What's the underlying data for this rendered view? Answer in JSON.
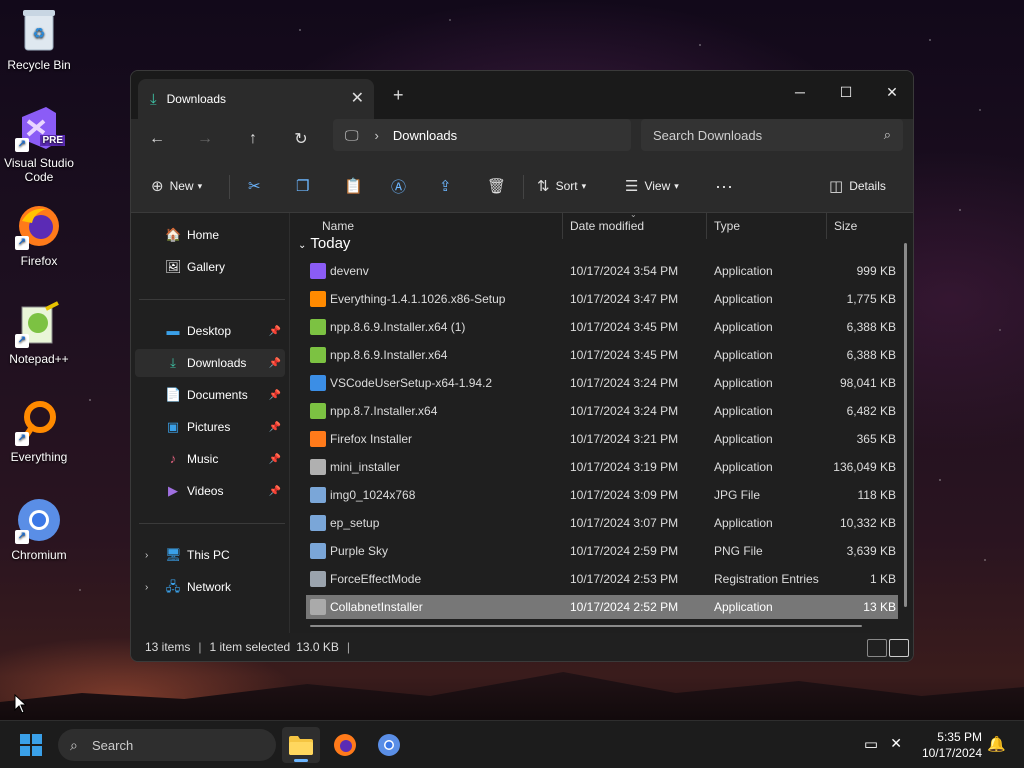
{
  "desktop": {
    "icons": [
      {
        "label": "Recycle Bin"
      },
      {
        "label": "Visual Studio Code",
        "badge": "PRE"
      },
      {
        "label": "Firefox"
      },
      {
        "label": "Notepad++"
      },
      {
        "label": "Everything"
      },
      {
        "label": "Chromium"
      }
    ]
  },
  "explorer": {
    "tab_title": "Downloads",
    "breadcrumb": "Downloads",
    "search_placeholder": "Search Downloads",
    "commands": {
      "new": "New",
      "sort": "Sort",
      "view": "View",
      "details": "Details"
    },
    "sidebar": {
      "items": [
        {
          "label": "Home"
        },
        {
          "label": "Gallery"
        },
        {
          "label": "Desktop"
        },
        {
          "label": "Downloads"
        },
        {
          "label": "Documents"
        },
        {
          "label": "Pictures"
        },
        {
          "label": "Music"
        },
        {
          "label": "Videos"
        },
        {
          "label": "This PC"
        },
        {
          "label": "Network"
        }
      ]
    },
    "columns": {
      "name": "Name",
      "date": "Date modified",
      "type": "Type",
      "size": "Size"
    },
    "group_label": "Today",
    "files": [
      {
        "name": "devenv",
        "date": "10/17/2024 3:54 PM",
        "type": "Application",
        "size": "999 KB"
      },
      {
        "name": "Everything-1.4.1.1026.x86-Setup",
        "date": "10/17/2024 3:47 PM",
        "type": "Application",
        "size": "1,775 KB"
      },
      {
        "name": "npp.8.6.9.Installer.x64 (1)",
        "date": "10/17/2024 3:45 PM",
        "type": "Application",
        "size": "6,388 KB"
      },
      {
        "name": "npp.8.6.9.Installer.x64",
        "date": "10/17/2024 3:45 PM",
        "type": "Application",
        "size": "6,388 KB"
      },
      {
        "name": "VSCodeUserSetup-x64-1.94.2",
        "date": "10/17/2024 3:24 PM",
        "type": "Application",
        "size": "98,041 KB"
      },
      {
        "name": "npp.8.7.Installer.x64",
        "date": "10/17/2024 3:24 PM",
        "type": "Application",
        "size": "6,482 KB"
      },
      {
        "name": "Firefox Installer",
        "date": "10/17/2024 3:21 PM",
        "type": "Application",
        "size": "365 KB"
      },
      {
        "name": "mini_installer",
        "date": "10/17/2024 3:19 PM",
        "type": "Application",
        "size": "136,049 KB"
      },
      {
        "name": "img0_1024x768",
        "date": "10/17/2024 3:09 PM",
        "type": "JPG File",
        "size": "118 KB"
      },
      {
        "name": "ep_setup",
        "date": "10/17/2024 3:07 PM",
        "type": "Application",
        "size": "10,332 KB"
      },
      {
        "name": "Purple Sky",
        "date": "10/17/2024 2:59 PM",
        "type": "PNG File",
        "size": "3,639 KB"
      },
      {
        "name": "ForceEffectMode",
        "date": "10/17/2024 2:53 PM",
        "type": "Registration Entries",
        "size": "1 KB"
      },
      {
        "name": "CollabnetInstaller",
        "date": "10/17/2024 2:52 PM",
        "type": "Application",
        "size": "13 KB"
      }
    ],
    "status": {
      "items": "13 items",
      "selected": "1 item selected",
      "size": "13.0 KB"
    }
  },
  "taskbar": {
    "search_placeholder": "Search",
    "time": "5:35 PM",
    "date": "10/17/2024"
  },
  "colors": {
    "accent": "#6cb6ff",
    "selection": "#777777",
    "window_bg": "#202020"
  }
}
